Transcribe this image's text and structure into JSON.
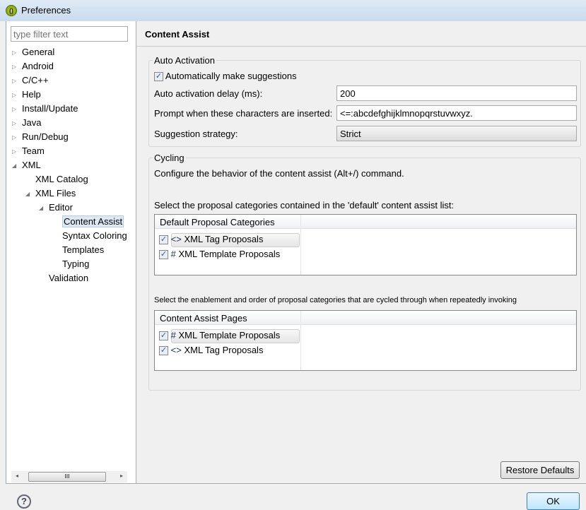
{
  "window": {
    "title": "Preferences"
  },
  "sidebar": {
    "filter_placeholder": "type filter text",
    "items": [
      {
        "label": "General",
        "expander": "collapsed"
      },
      {
        "label": "Android",
        "expander": "collapsed"
      },
      {
        "label": "C/C++",
        "expander": "collapsed"
      },
      {
        "label": "Help",
        "expander": "collapsed"
      },
      {
        "label": "Install/Update",
        "expander": "collapsed"
      },
      {
        "label": "Java",
        "expander": "collapsed"
      },
      {
        "label": "Run/Debug",
        "expander": "collapsed"
      },
      {
        "label": "Team",
        "expander": "collapsed"
      },
      {
        "label": "XML",
        "expander": "expanded"
      },
      {
        "label": "XML Catalog"
      },
      {
        "label": "XML Files",
        "expander": "expanded"
      },
      {
        "label": "Editor",
        "expander": "expanded"
      },
      {
        "label": "Content Assist",
        "selected": true
      },
      {
        "label": "Syntax Coloring"
      },
      {
        "label": "Templates"
      },
      {
        "label": "Typing"
      },
      {
        "label": "Validation"
      }
    ],
    "scrollbar_grip": "III"
  },
  "page": {
    "title": "Content Assist",
    "auto_activation": {
      "group_label": "Auto Activation",
      "auto_suggest_label": "Automatically make suggestions",
      "auto_suggest_checked": true,
      "delay_label": "Auto activation delay (ms):",
      "delay_value": "200",
      "prompt_label": "Prompt when these characters are inserted:",
      "prompt_value": "<=:abcdefghijklmnopqrstuvwxyz.",
      "strategy_label": "Suggestion strategy:",
      "strategy_value": "Strict"
    },
    "cycling": {
      "group_label": "Cycling",
      "description": "Configure the behavior of the content assist (Alt+/) command.",
      "default_label": "Select the proposal categories contained in the 'default' content assist list:",
      "default_table": {
        "header": "Default Proposal Categories",
        "rows": [
          {
            "icon": "<>",
            "label": "XML Tag Proposals",
            "checked": true
          },
          {
            "icon": "#",
            "label": "XML Template Proposals",
            "checked": true
          }
        ]
      },
      "pages_label": "Select the enablement and order of proposal categories that are cycled through when repeatedly invoking",
      "pages_table": {
        "header": "Content Assist Pages",
        "rows": [
          {
            "icon": "#",
            "label": "XML Template Proposals",
            "checked": true
          },
          {
            "icon": "<>",
            "label": "XML Tag Proposals",
            "checked": true
          }
        ]
      }
    },
    "restore_label": "Restore Defaults"
  },
  "footer": {
    "help_icon": "?",
    "ok_label": "OK"
  }
}
